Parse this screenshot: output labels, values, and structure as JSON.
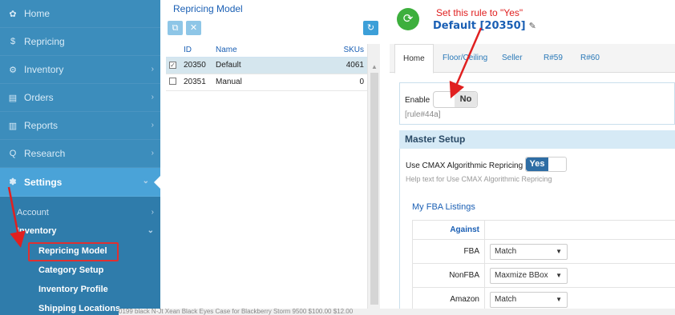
{
  "sidebar": {
    "items": [
      {
        "icon": "home-icon",
        "glyph": "✿",
        "label": "Home"
      },
      {
        "icon": "dollar-icon",
        "glyph": "$",
        "label": "Repricing"
      },
      {
        "icon": "cubes-icon",
        "glyph": "⚙",
        "label": "Inventory"
      },
      {
        "icon": "list-icon",
        "glyph": "▤",
        "label": "Orders"
      },
      {
        "icon": "bar-chart-icon",
        "glyph": "▥",
        "label": "Reports"
      },
      {
        "icon": "search-icon",
        "glyph": "Q",
        "label": "Research"
      },
      {
        "icon": "gear-icon",
        "glyph": "✽",
        "label": "Settings"
      }
    ],
    "sub_items": {
      "account": "Account",
      "inventory": "Inventory",
      "repricing_model": "Repricing Model",
      "category_setup": "Category Setup",
      "inventory_profile": "Inventory Profile",
      "shipping_locations": "Shipping Locations"
    }
  },
  "middle": {
    "title": "Repricing Model",
    "columns": {
      "id": "ID",
      "name": "Name",
      "skus": "SKUs"
    },
    "rows": [
      {
        "id": "20350",
        "name": "Default",
        "skus": "4061",
        "checked": true
      },
      {
        "id": "20351",
        "name": "Manual",
        "skus": "0",
        "checked": false
      }
    ]
  },
  "right": {
    "annotation": "Set this rule to \"Yes\"",
    "rule_title": "Default [20350]",
    "tabs": [
      "Home",
      "Floor/Ceiling",
      "Seller",
      "R#59",
      "R#60"
    ],
    "enable": {
      "label": "Enable",
      "value": "No",
      "rule_id": "[rule#44a]"
    },
    "master_setup": {
      "header": "Master Setup",
      "cmax_label": "Use CMAX Algorithmic Repricing",
      "cmax_value": "Yes",
      "help": "Help text for Use CMAX Algorithmic Repricing"
    },
    "fba": {
      "title": "My FBA Listings",
      "against_label": "Against",
      "rows": [
        {
          "label": "FBA",
          "value": "Match"
        },
        {
          "label": "NonFBA",
          "value": "Maxmize BBox"
        },
        {
          "label": "Amazon",
          "value": "Match"
        }
      ]
    }
  },
  "bottom_strip": "0199 black        N-Jt Xean Black Eyes Case for Blackberry Storm 9500        $100.00        $12.00"
}
